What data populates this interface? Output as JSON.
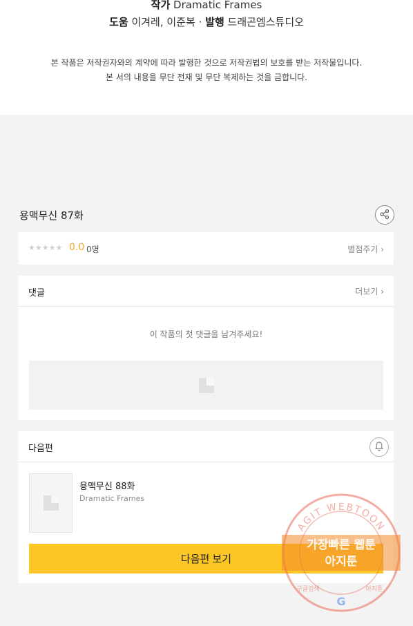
{
  "credits": {
    "author_label": "작가",
    "author_value": "Dramatic Frames",
    "assist_label": "도움",
    "assist_value": "이겨레, 이준복",
    "separator": "·",
    "publisher_label": "발행",
    "publisher_value": "드래곤엠스튜디오"
  },
  "notice": {
    "line1": "본 작품은 저작권자와의 계약에 따라 발행한 것으로 저작권법의 보호를 받는 저작물입니다.",
    "line2": "본 서의 내용을 무단 전재 및 무단 복제하는 것을 금합니다."
  },
  "episode": {
    "title": "용맥무신 87화",
    "share_icon": "share-icon"
  },
  "rating": {
    "stars": "★★★★★",
    "score": "0.0",
    "count": "0명",
    "rate_label": "별점주기",
    "chevron": "›",
    "star_color": "#cfcfcf",
    "score_color": "#f5a623"
  },
  "comments": {
    "header": "댓글",
    "more_label": "더보기",
    "chevron": "›",
    "empty_message": "이 작품의 첫 댓글을 남겨주세요!"
  },
  "next": {
    "header": "다음편",
    "bell_icon": "bell-icon",
    "title": "용맥무신 88화",
    "author": "Dramatic Frames",
    "button_label": "다음편 보기",
    "button_color": "#fcc624"
  },
  "watermark": {
    "ring_text": "AGIT WEBTOON",
    "line1": "가장빠른 웹툰",
    "line2": "아지툰",
    "bottom_left": "구글검색",
    "bottom_right": "아지툰",
    "color": "#e86a5a"
  }
}
